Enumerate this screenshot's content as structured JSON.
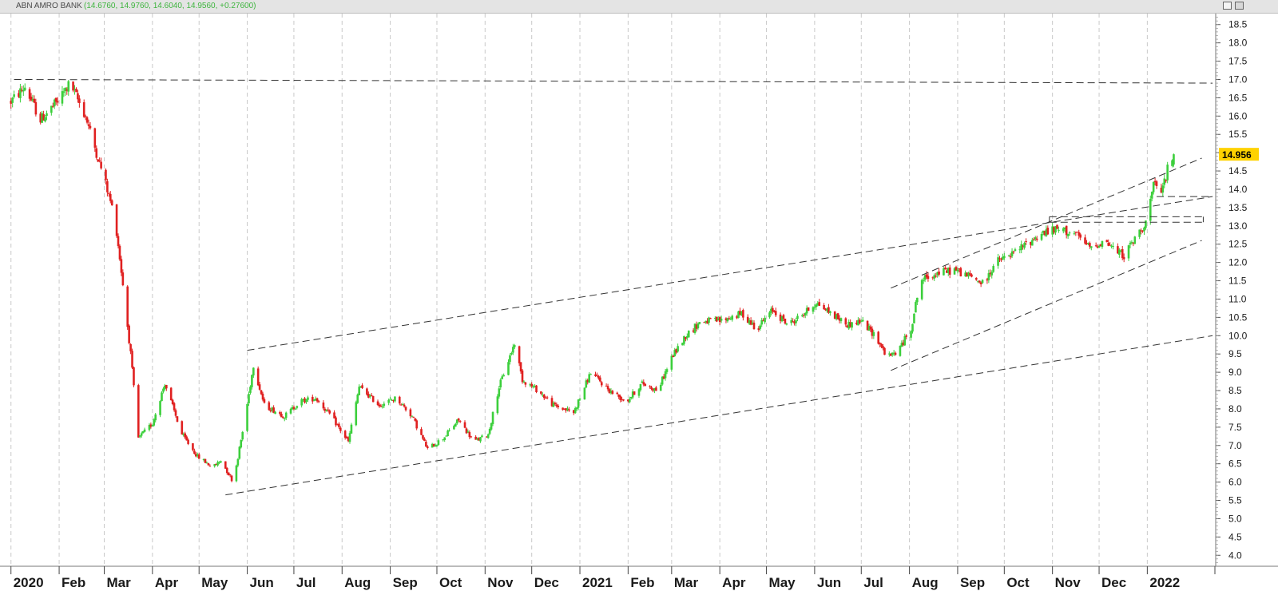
{
  "title_bar": {
    "name": "ABN AMRO BANK",
    "values": "(14.6760, 14.9760, 14.6040, 14.9560, +0.27600)"
  },
  "price_label": "14.956",
  "colors": {
    "up": "#3ccf3c",
    "down": "#e02020",
    "grid": "#c9c9c9",
    "lines": "#333333",
    "price_tag": "#ffd200"
  },
  "chart_data": {
    "type": "candlestick",
    "title": "ABN AMRO BANK",
    "ylim": [
      3.7,
      18.8
    ],
    "y_ticks": [
      4.0,
      4.5,
      5.0,
      5.5,
      6.0,
      6.5,
      7.0,
      7.5,
      8.0,
      8.5,
      9.0,
      9.5,
      10.0,
      10.5,
      11.0,
      11.5,
      12.0,
      12.5,
      13.0,
      13.5,
      14.0,
      14.5,
      15.0,
      15.5,
      16.0,
      16.5,
      17.0,
      17.5,
      18.0,
      18.5
    ],
    "x_labels": [
      "2020",
      "Feb",
      "Mar",
      "Apr",
      "May",
      "Jun",
      "Jul",
      "Aug",
      "Sep",
      "Oct",
      "Nov",
      "Dec",
      "2021",
      "Feb",
      "Mar",
      "Apr",
      "May",
      "Jun",
      "Jul",
      "Aug",
      "Sep",
      "Oct",
      "Nov",
      "Dec",
      "2022"
    ],
    "x_dates": [
      "2020-01",
      "2020-02",
      "2020-03",
      "2020-04",
      "2020-05",
      "2020-06",
      "2020-07",
      "2020-08",
      "2020-09",
      "2020-10",
      "2020-11",
      "2020-12",
      "2021-01",
      "2021-02",
      "2021-03",
      "2021-04",
      "2021-05",
      "2021-06",
      "2021-07",
      "2021-08",
      "2021-09",
      "2021-10",
      "2021-11",
      "2021-12",
      "2022-01"
    ],
    "price_path": [
      [
        "2020-01-01",
        16.4
      ],
      [
        "2020-01-10",
        16.8
      ],
      [
        "2020-01-20",
        15.9
      ],
      [
        "2020-01-31",
        16.4
      ],
      [
        "2020-02-08",
        16.9
      ],
      [
        "2020-02-18",
        16.0
      ],
      [
        "2020-02-25",
        15.0
      ],
      [
        "2020-03-01",
        14.3
      ],
      [
        "2020-03-08",
        13.2
      ],
      [
        "2020-03-13",
        11.4
      ],
      [
        "2020-03-18",
        9.5
      ],
      [
        "2020-03-23",
        7.2
      ],
      [
        "2020-04-01",
        7.6
      ],
      [
        "2020-04-09",
        8.7
      ],
      [
        "2020-04-20",
        7.3
      ],
      [
        "2020-04-30",
        6.7
      ],
      [
        "2020-05-10",
        6.4
      ],
      [
        "2020-05-15",
        6.6
      ],
      [
        "2020-05-23",
        6.0
      ],
      [
        "2020-05-30",
        7.6
      ],
      [
        "2020-06-05",
        9.2
      ],
      [
        "2020-06-12",
        8.1
      ],
      [
        "2020-06-25",
        7.8
      ],
      [
        "2020-07-05",
        8.2
      ],
      [
        "2020-07-15",
        8.3
      ],
      [
        "2020-07-25",
        7.8
      ],
      [
        "2020-08-05",
        7.1
      ],
      [
        "2020-08-12",
        8.6
      ],
      [
        "2020-08-25",
        8.1
      ],
      [
        "2020-09-05",
        8.3
      ],
      [
        "2020-09-15",
        7.8
      ],
      [
        "2020-09-25",
        6.9
      ],
      [
        "2020-10-05",
        7.2
      ],
      [
        "2020-10-15",
        7.7
      ],
      [
        "2020-10-25",
        7.1
      ],
      [
        "2020-11-03",
        7.3
      ],
      [
        "2020-11-10",
        8.6
      ],
      [
        "2020-11-20",
        9.8
      ],
      [
        "2020-11-25",
        8.8
      ],
      [
        "2020-12-05",
        8.5
      ],
      [
        "2020-12-15",
        8.1
      ],
      [
        "2020-12-28",
        7.9
      ],
      [
        "2021-01-08",
        9.0
      ],
      [
        "2021-01-20",
        8.5
      ],
      [
        "2021-01-31",
        8.2
      ],
      [
        "2021-02-10",
        8.7
      ],
      [
        "2021-02-20",
        8.5
      ],
      [
        "2021-03-01",
        9.4
      ],
      [
        "2021-03-10",
        10.0
      ],
      [
        "2021-03-20",
        10.4
      ],
      [
        "2021-04-01",
        10.4
      ],
      [
        "2021-04-15",
        10.6
      ],
      [
        "2021-04-25",
        10.2
      ],
      [
        "2021-05-05",
        10.7
      ],
      [
        "2021-05-15",
        10.3
      ],
      [
        "2021-05-25",
        10.6
      ],
      [
        "2021-06-02",
        10.9
      ],
      [
        "2021-06-12",
        10.6
      ],
      [
        "2021-06-22",
        10.3
      ],
      [
        "2021-07-01",
        10.4
      ],
      [
        "2021-07-10",
        10.0
      ],
      [
        "2021-07-18",
        9.4
      ],
      [
        "2021-07-25",
        9.6
      ],
      [
        "2021-08-02",
        10.2
      ],
      [
        "2021-08-08",
        11.5
      ],
      [
        "2021-08-18",
        11.7
      ],
      [
        "2021-08-30",
        11.8
      ],
      [
        "2021-09-10",
        11.6
      ],
      [
        "2021-09-18",
        11.4
      ],
      [
        "2021-09-25",
        12.0
      ],
      [
        "2021-10-05",
        12.2
      ],
      [
        "2021-10-15",
        12.5
      ],
      [
        "2021-10-25",
        12.8
      ],
      [
        "2021-11-05",
        12.9
      ],
      [
        "2021-11-15",
        12.8
      ],
      [
        "2021-11-25",
        12.4
      ],
      [
        "2021-12-05",
        12.6
      ],
      [
        "2021-12-12",
        12.3
      ],
      [
        "2021-12-17",
        12.2
      ],
      [
        "2021-12-25",
        12.7
      ],
      [
        "2021-12-31",
        13.1
      ],
      [
        "2022-01-05",
        14.1
      ],
      [
        "2022-01-10",
        13.9
      ],
      [
        "2022-01-15",
        14.7
      ],
      [
        "2022-01-18",
        14.956
      ]
    ],
    "trend_lines": [
      {
        "from": [
          "2020-01-03",
          17.0
        ],
        "to": [
          "2022-02-12",
          16.9
        ]
      },
      {
        "from": [
          "2020-05-18",
          5.65
        ],
        "to": [
          "2022-02-12",
          10.0
        ]
      },
      {
        "from": [
          "2020-06-01",
          9.6
        ],
        "to": [
          "2022-02-12",
          13.8
        ]
      },
      {
        "from": [
          "2021-07-20",
          9.05
        ],
        "to": [
          "2022-02-05",
          12.6
        ]
      },
      {
        "from": [
          "2021-07-20",
          11.3
        ],
        "to": [
          "2022-02-05",
          14.85
        ]
      },
      {
        "from": [
          "2021-10-30",
          13.25
        ],
        "to": [
          "2022-02-06",
          13.25
        ]
      },
      {
        "from": [
          "2021-10-30",
          13.1
        ],
        "to": [
          "2022-02-06",
          13.1
        ]
      },
      {
        "from": [
          "2022-01-07",
          13.8
        ],
        "to": [
          "2022-02-12",
          13.8
        ]
      }
    ]
  }
}
